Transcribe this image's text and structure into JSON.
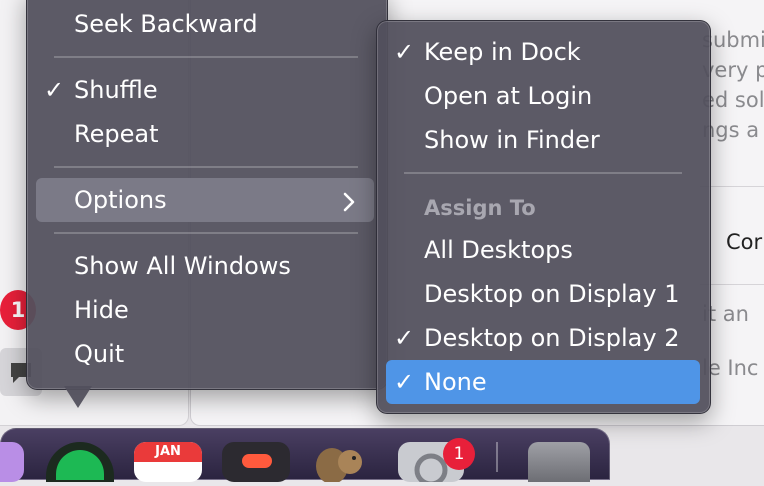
{
  "background": {
    "right_texts": [
      "submi",
      "very p",
      "ed solu",
      "ngs a"
    ],
    "con_label": "Cor",
    "lower_texts": [
      "it an",
      "le Inc"
    ],
    "badge_count": "1"
  },
  "main_menu": {
    "items": [
      {
        "label": "Seek Backward",
        "checked": false
      },
      {
        "label": "Shuffle",
        "checked": true
      },
      {
        "label": "Repeat",
        "checked": false
      },
      {
        "label": "Options",
        "checked": false,
        "highlighted": true,
        "has_submenu": true
      },
      {
        "label": "Show All Windows",
        "checked": false
      },
      {
        "label": "Hide",
        "checked": false
      },
      {
        "label": "Quit",
        "checked": false
      }
    ]
  },
  "options_submenu": {
    "items": [
      {
        "label": "Keep in Dock",
        "checked": true
      },
      {
        "label": "Open at Login",
        "checked": false
      },
      {
        "label": "Show in Finder",
        "checked": false
      }
    ],
    "assign_header": "Assign To",
    "assign_items": [
      {
        "label": "All Desktops",
        "checked": false
      },
      {
        "label": "Desktop on Display 1",
        "checked": false
      },
      {
        "label": "Desktop on Display 2",
        "checked": true
      },
      {
        "label": "None",
        "checked": true,
        "selected": true
      }
    ]
  },
  "dock": {
    "calendar_month": "JAN",
    "settings_badge": "1"
  },
  "checkmark": "✓",
  "colors": {
    "menu_bg": "#52505c",
    "selection": "#4f95e7",
    "badge": "#e8203a"
  }
}
